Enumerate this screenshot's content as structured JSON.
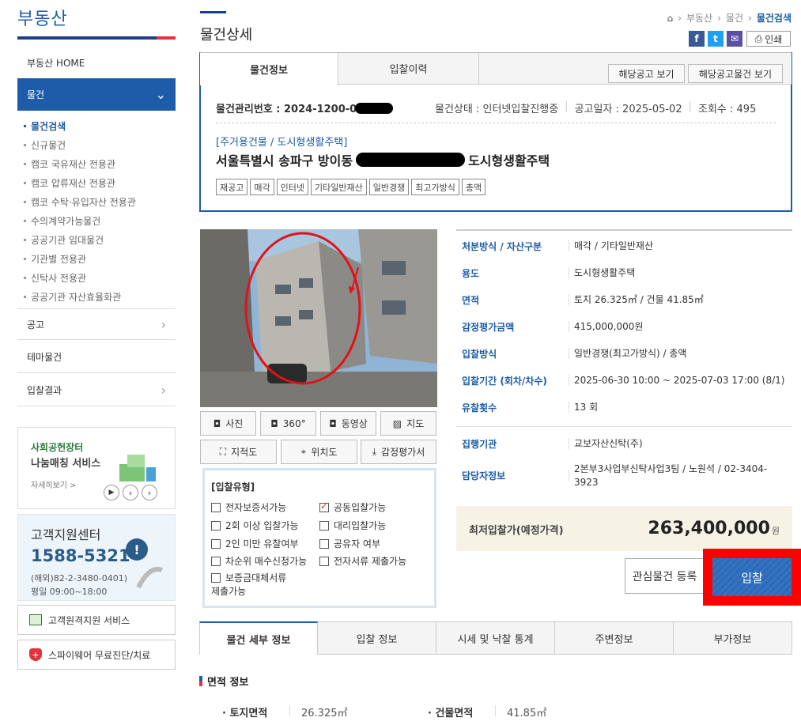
{
  "sidebar": {
    "title": "부동산",
    "home": "부동산 HOME",
    "property": "물건",
    "subs": [
      "물건검색",
      "신규물건",
      "캠코 국유재산 전용관",
      "캠코 압류재산 전용관",
      "캠코 수탁·유입자산 전용관",
      "수의계약가능물건",
      "공공기관 임대물건",
      "기관별 전용관",
      "신탁사 전용관",
      "공공기관 자산효율화관"
    ],
    "notice": "공고",
    "theme": "테마물건",
    "result": "입찰결과",
    "promo": {
      "line1": "사회공헌장터",
      "line2": "나눔매칭 서비스",
      "more": "자세히보기 >"
    },
    "cs": {
      "title": "고객지원센터",
      "phone": "1588-5321",
      "overseas": "(해외)82-2-3480-0401)",
      "hours": "평일 09:00~18:00"
    },
    "remote": "고객원격지원 서비스",
    "spyware": "스파이웨어 무료진단/치료"
  },
  "header": {
    "title": "물건상세",
    "crumbs": [
      "부동산",
      "물건"
    ],
    "current": "물건검색",
    "print": "인쇄"
  },
  "tabs": {
    "info": "물건정보",
    "history": "입찰이력",
    "btn1": "해당공고 보기",
    "btn2": "해당공고물건 보기"
  },
  "item": {
    "mgmt_label": "물건관리번호 : 2024-1200-0",
    "status": "물건상태 : 인터넷입찰진행중",
    "notice_date": "공고일자 : 2025-05-02",
    "views": "조회수 : 495",
    "category": "[주거용건물 / 도시형생활주택]",
    "address_a": "서울특별시 송파구 방이동",
    "address_b": "도시형생활주택",
    "chips": [
      "재공고",
      "매각",
      "인터넷",
      "기타일반재산",
      "일반경쟁",
      "최고가방식",
      "총액"
    ]
  },
  "media": {
    "photo": "사진",
    "deg": "360°",
    "video": "동영상",
    "map": "지도",
    "cadastral": "지적도",
    "location": "위치도",
    "appraisal": "감정평가서"
  },
  "bidtype": {
    "title": "[입찰유형]",
    "left": [
      {
        "label": "전자보증서가능",
        "checked": false
      },
      {
        "label": "2회 이상 입찰가능",
        "checked": false
      },
      {
        "label": "2인 미만 유찰여부",
        "checked": false
      },
      {
        "label": "차순위 매수신청가능",
        "checked": false
      },
      {
        "label": "보증금대체서류",
        "checked": false
      }
    ],
    "left_extra": "제출가능",
    "right": [
      {
        "label": "공동입찰가능",
        "checked": true
      },
      {
        "label": "대리입찰가능",
        "checked": false
      },
      {
        "label": "공유자 여부",
        "checked": false
      },
      {
        "label": "전자서류 제출가능",
        "checked": false
      }
    ]
  },
  "details": [
    {
      "label": "처분방식 / 자산구분",
      "value": "매각 / 기타일반재산"
    },
    {
      "label": "용도",
      "value": "도시형생활주택"
    },
    {
      "label": "면적",
      "value": "토지 26.325㎡ / 건물 41.85㎡"
    },
    {
      "label": "감정평가금액",
      "value": "415,000,000원"
    },
    {
      "label": "입찰방식",
      "value": "일반경쟁(최고가방식) / 총액"
    },
    {
      "label": "입찰기간 (회차/차수)",
      "value": "2025-06-30 10:00 ~ 2025-07-03 17:00 (8/1)"
    },
    {
      "label": "유찰횟수",
      "value": "13 회"
    },
    {
      "label": "집행기관",
      "value": "교보자산신탁(주)"
    },
    {
      "label": "담당자정보",
      "value": "2본부3사업부신탁사업3팀 / 노원석 / 02-3404-3923"
    }
  ],
  "price": {
    "label": "최저입찰가(예정가격)",
    "value": "263,400,000",
    "unit": "원"
  },
  "actions": {
    "watch": "관심물건 등록",
    "bid": "입찰"
  },
  "bottom_tabs": [
    "물건 세부 정보",
    "입찰 정보",
    "시세 및 낙찰 통계",
    "주변정보",
    "부가정보"
  ],
  "area": {
    "title": "면적 정보",
    "land_label": "· 토지면적",
    "land": "26.325㎡",
    "bldg_label": "· 건물면적",
    "bldg": "41.85㎡"
  },
  "colors": {
    "primary": "#1d5ca8",
    "highlight": "#ff0000"
  }
}
